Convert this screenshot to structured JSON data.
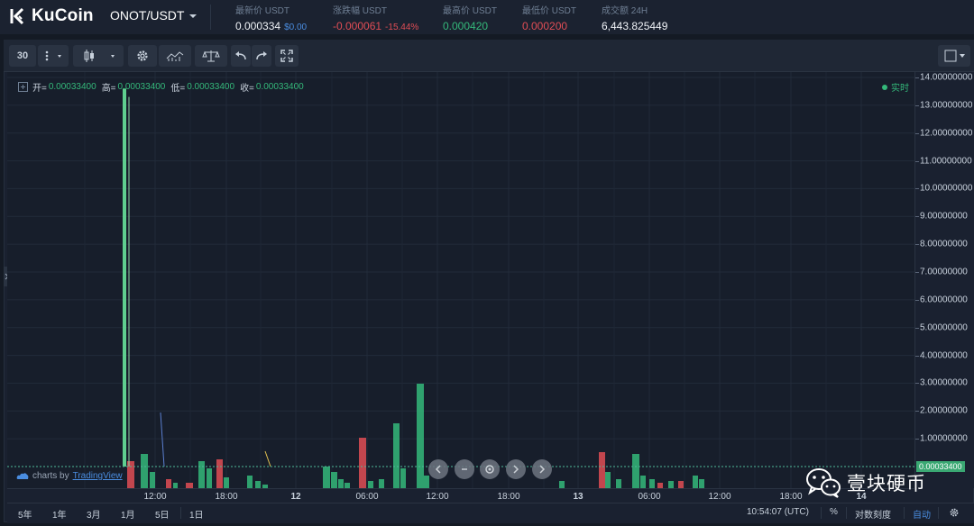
{
  "header": {
    "logo_text": "KuCoin",
    "pair": "ONOT/USDT",
    "stats": [
      {
        "label": "最新价 USDT",
        "value": "0.000334",
        "sub": "$0.00"
      },
      {
        "label": "涨跌幅 USDT",
        "value": "-0.000061",
        "sub": "-15.44%"
      },
      {
        "label": "最高价 USDT",
        "value": "0.000420"
      },
      {
        "label": "最低价 USDT",
        "value": "0.000200"
      },
      {
        "label": "成交额 24H",
        "value": "6,443.825449"
      }
    ]
  },
  "toolbar": {
    "interval": "30"
  },
  "legend": {
    "open_label": "开=",
    "open": "0.00033400",
    "high_label": "高=",
    "high": "0.00033400",
    "low_label": "低=",
    "low": "0.00033400",
    "close_label": "收=",
    "close": "0.00033400",
    "realtime": "实时"
  },
  "branding": {
    "charts_by": "charts by",
    "tradingview": "TradingView"
  },
  "price_scale": {
    "ticks": [
      "14.00000000",
      "13.00000000",
      "12.00000000",
      "11.00000000",
      "10.00000000",
      "9.00000000",
      "8.00000000",
      "7.00000000",
      "6.00000000",
      "5.00000000",
      "4.00000000",
      "3.00000000",
      "2.00000000",
      "1.00000000"
    ],
    "current_price": "0.00033400"
  },
  "time_scale": {
    "ticks": [
      {
        "label": "12:00",
        "bold": false
      },
      {
        "label": "18:00",
        "bold": false
      },
      {
        "label": "12",
        "bold": true
      },
      {
        "label": "06:00",
        "bold": false
      },
      {
        "label": "12:00",
        "bold": false
      },
      {
        "label": "18:00",
        "bold": false
      },
      {
        "label": "13",
        "bold": true
      },
      {
        "label": "06:00",
        "bold": false
      },
      {
        "label": "12:00",
        "bold": false
      },
      {
        "label": "18:00",
        "bold": false
      },
      {
        "label": "14",
        "bold": true
      }
    ]
  },
  "bottom_bar": {
    "ranges": [
      "5年",
      "1年",
      "3月",
      "1月",
      "5日",
      "1日"
    ],
    "clock": "10:54:07 (UTC)",
    "percent": "%",
    "log_scale": "对数刻度",
    "auto": "自动"
  },
  "watermark": {
    "text": "壹块硬币"
  },
  "colors": {
    "up": "#34b87a",
    "down": "#e04d55",
    "accent": "#4a8de0"
  },
  "chart_data": {
    "type": "candlestick+volume",
    "ylim": [
      0,
      14
    ],
    "current_price": 0.000334,
    "price_scale_labels": [
      "14.00000000",
      "13.00000000",
      "12.00000000",
      "11.00000000",
      "10.00000000",
      "9.00000000",
      "8.00000000",
      "7.00000000",
      "6.00000000",
      "5.00000000",
      "4.00000000",
      "3.00000000",
      "2.00000000",
      "1.00000000"
    ],
    "x_labels": [
      "12:00",
      "18:00",
      "12",
      "06:00",
      "12:00",
      "18:00",
      "13",
      "06:00",
      "12:00",
      "18:00",
      "14"
    ],
    "spike_candle": {
      "open": 0.0,
      "high": 13.6,
      "low": 0.0,
      "close": 13.3,
      "direction": "up"
    }
  }
}
